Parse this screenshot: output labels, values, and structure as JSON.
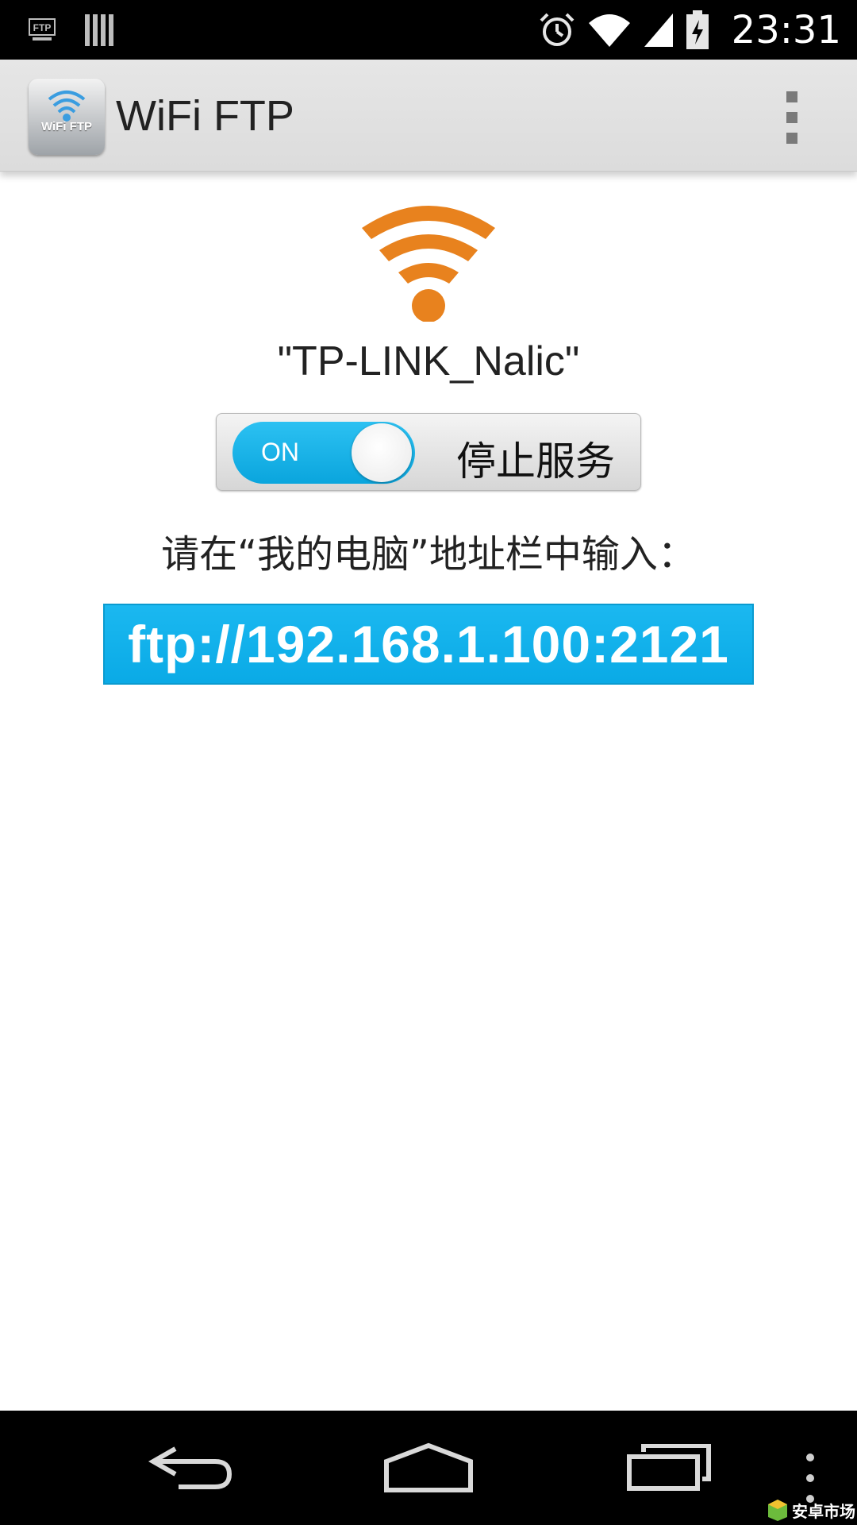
{
  "status_bar": {
    "time": "23:31",
    "icons": [
      "ftp-notification-icon",
      "barcode-notification-icon",
      "alarm-icon",
      "wifi-signal-icon",
      "cell-signal-icon",
      "battery-charging-icon"
    ],
    "ftp_icon_text": "FTP"
  },
  "action_bar": {
    "app_title": "WiFi FTP",
    "app_icon_text": "WiFi FTP",
    "overflow_icon": "overflow-menu-icon"
  },
  "main": {
    "wifi_icon_color": "#e8821e",
    "ssid": "\"TP-LINK_Nalic\"",
    "toggle": {
      "state_label": "ON",
      "is_on": true,
      "accent": "#12b0ea"
    },
    "service_label": "停止服务",
    "instruction": "请在“我的电脑”地址栏中输入：",
    "ftp_address": "ftp://192.168.1.100:2121",
    "ftp_box_color": "#12b0ea"
  },
  "nav_bar": {
    "buttons": [
      "back-icon",
      "home-icon",
      "recent-apps-icon",
      "menu-icon"
    ]
  },
  "watermark": {
    "text": "安卓市场"
  }
}
